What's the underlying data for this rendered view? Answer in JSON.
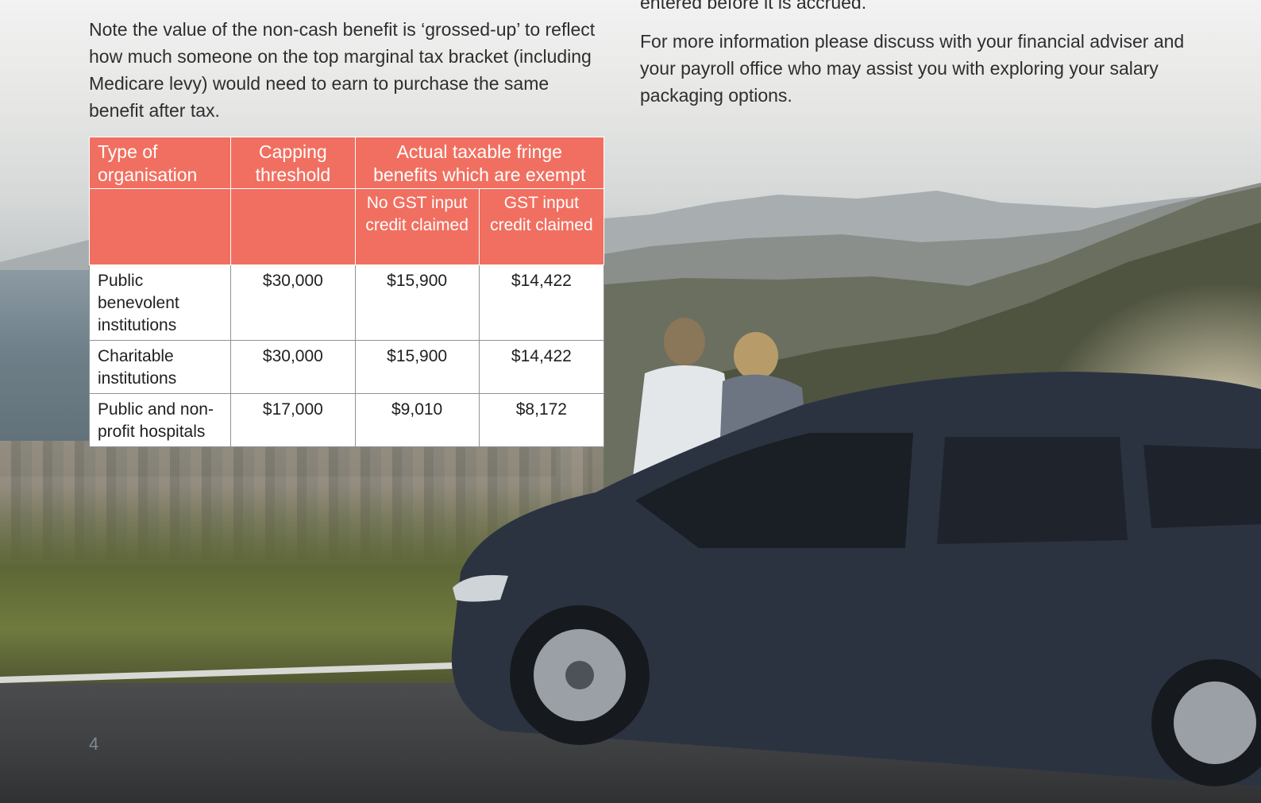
{
  "text": {
    "right_top_partial": "entered before it is accrued.",
    "left_paragraph": "Note the value of the non-cash benefit is ‘grossed-up’ to reflect how much someone on the top marginal tax bracket (including Medicare levy) would need to earn to purchase the same benefit after tax.",
    "right_paragraph": "For more information please discuss with your financial adviser and your payroll office who may assist you with exploring your salary packaging options.",
    "page_number": "4"
  },
  "table": {
    "headers": {
      "type_of_organisation": "Type of organisation",
      "capping_threshold": "Capping threshold",
      "actual_taxable": "Actual taxable fringe benefits which are exempt",
      "no_gst": "No GST input credit claimed",
      "gst": "GST input credit claimed"
    },
    "rows": [
      {
        "organisation": "Public benevolent institutions",
        "threshold": "$30,000",
        "no_gst": "$15,900",
        "gst": "$14,422"
      },
      {
        "organisation": "Charitable institutions",
        "threshold": "$30,000",
        "no_gst": "$15,900",
        "gst": "$14,422"
      },
      {
        "organisation": "Public and non-profit hospitals",
        "threshold": "$17,000",
        "no_gst": "$9,010",
        "gst": "$8,172"
      }
    ]
  },
  "colors": {
    "table_header": "#f16f60",
    "body_text": "#2e2e2e",
    "page_number": "#7d8a94"
  }
}
